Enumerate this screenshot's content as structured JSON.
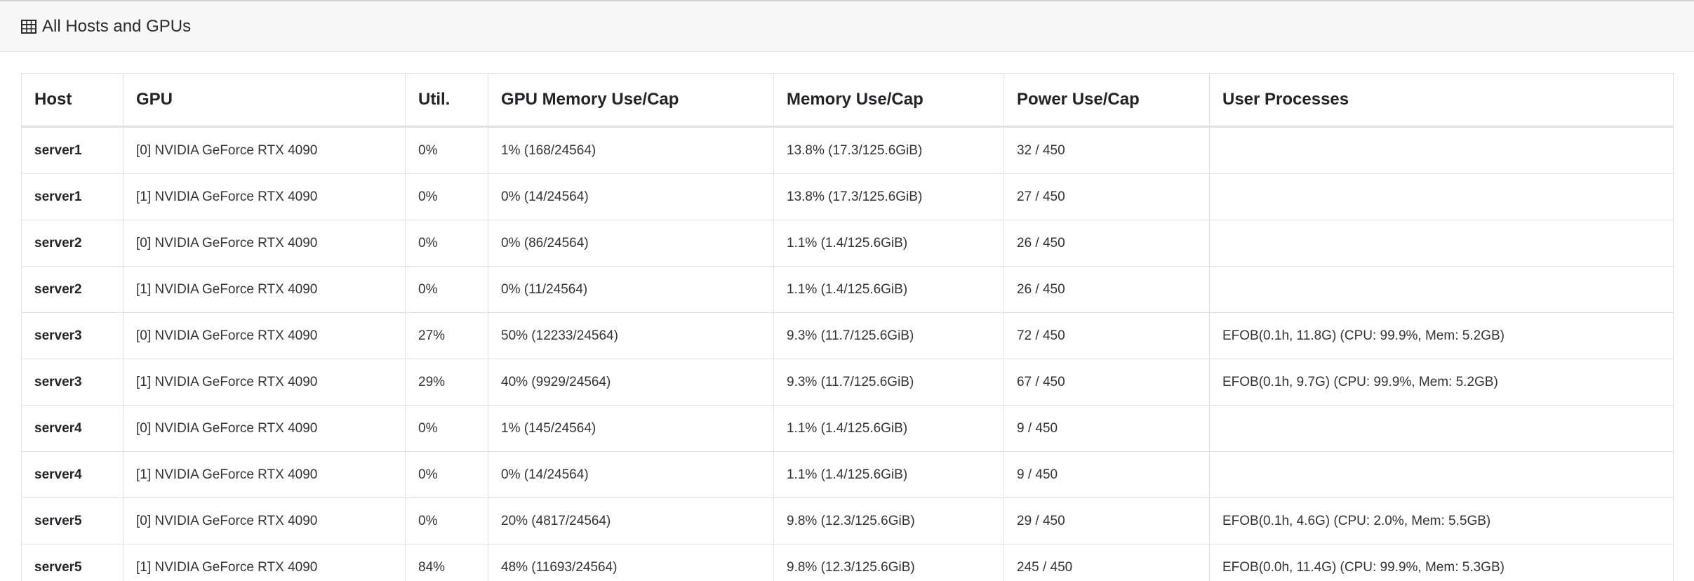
{
  "header": {
    "title": "All Hosts and GPUs",
    "icon": "table-icon"
  },
  "table": {
    "columns": [
      "Host",
      "GPU",
      "Util.",
      "GPU Memory Use/Cap",
      "Memory Use/Cap",
      "Power Use/Cap",
      "User Processes"
    ],
    "rows": [
      [
        "server1",
        "[0] NVIDIA GeForce RTX 4090",
        "0%",
        "1% (168/24564)",
        "13.8% (17.3/125.6GiB)",
        "32 / 450",
        ""
      ],
      [
        "server1",
        "[1] NVIDIA GeForce RTX 4090",
        "0%",
        "0% (14/24564)",
        "13.8% (17.3/125.6GiB)",
        "27 / 450",
        ""
      ],
      [
        "server2",
        "[0] NVIDIA GeForce RTX 4090",
        "0%",
        "0% (86/24564)",
        "1.1% (1.4/125.6GiB)",
        "26 / 450",
        ""
      ],
      [
        "server2",
        "[1] NVIDIA GeForce RTX 4090",
        "0%",
        "0% (11/24564)",
        "1.1% (1.4/125.6GiB)",
        "26 / 450",
        ""
      ],
      [
        "server3",
        "[0] NVIDIA GeForce RTX 4090",
        "27%",
        "50% (12233/24564)",
        "9.3% (11.7/125.6GiB)",
        "72 / 450",
        "EFOB(0.1h, 11.8G) (CPU: 99.9%, Mem: 5.2GB)"
      ],
      [
        "server3",
        "[1] NVIDIA GeForce RTX 4090",
        "29%",
        "40% (9929/24564)",
        "9.3% (11.7/125.6GiB)",
        "67 / 450",
        "EFOB(0.1h, 9.7G) (CPU: 99.9%, Mem: 5.2GB)"
      ],
      [
        "server4",
        "[0] NVIDIA GeForce RTX 4090",
        "0%",
        "1% (145/24564)",
        "1.1% (1.4/125.6GiB)",
        "9 / 450",
        ""
      ],
      [
        "server4",
        "[1] NVIDIA GeForce RTX 4090",
        "0%",
        "0% (14/24564)",
        "1.1% (1.4/125.6GiB)",
        "9 / 450",
        ""
      ],
      [
        "server5",
        "[0] NVIDIA GeForce RTX 4090",
        "0%",
        "20% (4817/24564)",
        "9.8% (12.3/125.6GiB)",
        "29 / 450",
        "EFOB(0.1h, 4.6G) (CPU: 2.0%, Mem: 5.5GB)"
      ],
      [
        "server5",
        "[1] NVIDIA GeForce RTX 4090",
        "84%",
        "48% (11693/24564)",
        "9.8% (12.3/125.6GiB)",
        "245 / 450",
        "EFOB(0.0h, 11.4G) (CPU: 99.9%, Mem: 5.3GB)"
      ]
    ]
  }
}
